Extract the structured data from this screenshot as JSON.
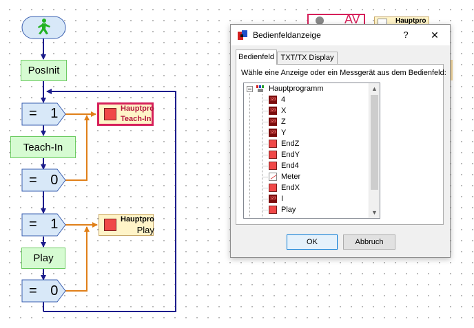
{
  "flowchart": {
    "start_icon": "walking-man-icon",
    "posinit": "PosInit",
    "cmp1": {
      "op": "=",
      "val": "1"
    },
    "teach_in": "Teach-In",
    "cmp2": {
      "op": "=",
      "val": "0"
    },
    "cmp3": {
      "op": "=",
      "val": "1"
    },
    "play": "Play",
    "cmp4": {
      "op": "=",
      "val": "0"
    },
    "panel1": {
      "line1": "Hauptpro",
      "line2": "Teach-In"
    },
    "panel2": {
      "line1": "Hauptpro",
      "line2": "Play"
    }
  },
  "background": {
    "av_text": "AV",
    "hp_partial": "Hauptpro"
  },
  "dialog": {
    "title": "Bedienfeldanzeige",
    "help": "?",
    "close": "✕",
    "tabs": [
      "Bedienfeld",
      "TXT/TX Display"
    ],
    "instruction": "Wähle eine Anzeige oder ein Messgerät aus dem Bedienfeld:",
    "tree": {
      "root": "Hauptprogramm",
      "items": [
        {
          "label": "4",
          "icon": "number-display-icon"
        },
        {
          "label": "X",
          "icon": "number-display-icon"
        },
        {
          "label": "Z",
          "icon": "number-display-icon"
        },
        {
          "label": "Y",
          "icon": "number-display-icon"
        },
        {
          "label": "EndZ",
          "icon": "lamp-icon"
        },
        {
          "label": "EndY",
          "icon": "lamp-icon"
        },
        {
          "label": "End4",
          "icon": "lamp-icon"
        },
        {
          "label": "Meter",
          "icon": "meter-icon"
        },
        {
          "label": "EndX",
          "icon": "lamp-icon"
        },
        {
          "label": "I",
          "icon": "number-display-icon"
        },
        {
          "label": "Play",
          "icon": "lamp-icon"
        }
      ]
    },
    "ok": "OK",
    "cancel": "Abbruch"
  },
  "colors": {
    "flow_line": "#1c1c8c",
    "branch_line": "#e07f18",
    "compare_fill": "#d8e8f8",
    "green_fill": "#d6fbd2",
    "panel_fill": "#fff4c8",
    "selected_border": "#d61f5a"
  }
}
